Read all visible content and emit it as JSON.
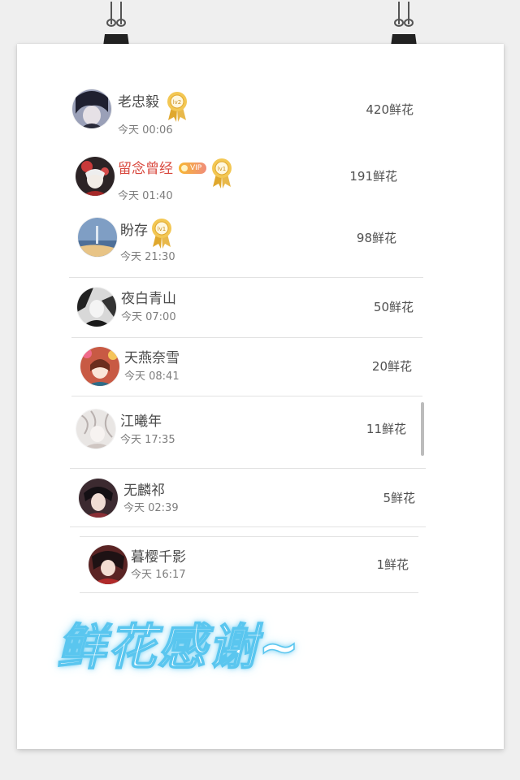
{
  "supporters": [
    {
      "name": "老忠毅",
      "time": "今天 00:06",
      "flowers": "420鲜花",
      "level": "lv2",
      "vip": false,
      "avatar_icon": "anime-boy-dark-avatar"
    },
    {
      "name": "留念曾经",
      "time": "今天 01:40",
      "flowers": "191鲜花",
      "level": "lv1",
      "vip": true,
      "vip_label": "VIP",
      "avatar_icon": "anime-girl-red-avatar"
    },
    {
      "name": "盼存",
      "time": "今天 21:30",
      "flowers": "98鲜花",
      "level": "lv1",
      "vip": false,
      "avatar_icon": "blue-scenery-avatar"
    },
    {
      "name": "夜白青山",
      "time": "今天 07:00",
      "flowers": "50鲜花",
      "avatar_icon": "monochrome-anime-avatar"
    },
    {
      "name": "天燕奈雪",
      "time": "今天 08:41",
      "flowers": "20鲜花",
      "avatar_icon": "flower-girl-avatar"
    },
    {
      "name": "江曦年",
      "time": "今天 17:35",
      "flowers": "11鲜花",
      "avatar_icon": "pale-sketch-avatar"
    },
    {
      "name": "无麟祁",
      "time": "今天 02:39",
      "flowers": "5鲜花",
      "avatar_icon": "dark-haired-boy-avatar"
    },
    {
      "name": "暮樱千影",
      "time": "今天 16:17",
      "flowers": "1鲜花",
      "avatar_icon": "red-robed-avatar"
    }
  ],
  "caption": "鲜花感谢~",
  "colors": {
    "vip_name": "#d9493f",
    "medal_gold": "#e0a82e",
    "caption_glow": "#5ac6ef",
    "divider": "#e2e2e2"
  }
}
